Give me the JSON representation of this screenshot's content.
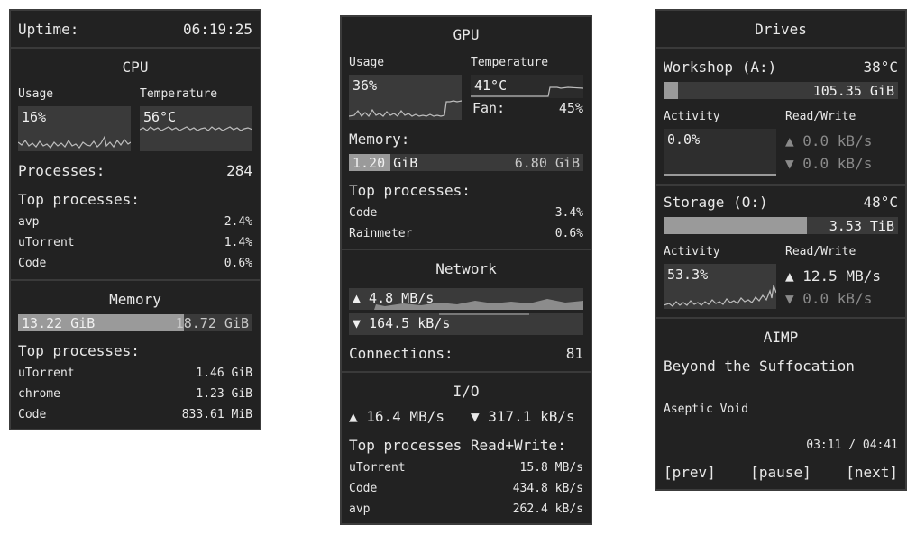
{
  "cpu_panel": {
    "uptime_label": "Uptime:",
    "uptime_value": "06:19:25",
    "title": "CPU",
    "usage_label": "Usage",
    "usage_value": "16%",
    "temp_label": "Temperature",
    "temp_value": "56°C",
    "processes_label": "Processes:",
    "processes_value": "284",
    "top_label": "Top processes:",
    "top": [
      {
        "name": "avp",
        "value": "2.4%"
      },
      {
        "name": "uTorrent",
        "value": "1.4%"
      },
      {
        "name": "Code",
        "value": "0.6%"
      }
    ],
    "memory_title": "Memory",
    "memory_used": "13.22 GiB",
    "memory_total": "18.72 GiB",
    "memory_fraction": 0.706,
    "mem_top_label": "Top processes:",
    "mem_top": [
      {
        "name": "uTorrent",
        "value": "1.46 GiB"
      },
      {
        "name": "chrome",
        "value": "1.23 GiB"
      },
      {
        "name": "Code",
        "value": "833.61 MiB"
      }
    ]
  },
  "gpu_panel": {
    "title": "GPU",
    "usage_label": "Usage",
    "usage_value": "36%",
    "temp_label": "Temperature",
    "temp_value": "41°C",
    "fan_label": "Fan:",
    "fan_value": "45%",
    "memory_label": "Memory:",
    "memory_used": "1.20 GiB",
    "memory_total": "6.80 GiB",
    "memory_fraction": 0.176,
    "top_label": "Top processes:",
    "top": [
      {
        "name": "Code",
        "value": "3.4%"
      },
      {
        "name": "Rainmeter",
        "value": "0.6%"
      }
    ],
    "network_title": "Network",
    "upload": "▲ 4.8 MB/s",
    "download": "▼ 164.5 kB/s",
    "connections_label": "Connections:",
    "connections_value": "81",
    "io_title": "I/O",
    "io_read": "▲ 16.4 MB/s",
    "io_write": "▼ 317.1 kB/s",
    "io_top_label": "Top processes Read+Write:",
    "io_top": [
      {
        "name": "uTorrent",
        "value": "15.8 MB/s"
      },
      {
        "name": "Code",
        "value": "434.8 kB/s"
      },
      {
        "name": "avp",
        "value": "262.4 kB/s"
      }
    ]
  },
  "drives_panel": {
    "title": "Drives",
    "drives": [
      {
        "name": "Workshop (A:)",
        "temp": "38°C",
        "free": "105.35 GiB",
        "used_fraction": 0.06,
        "activity_label": "Activity",
        "activity_value": "0.0%",
        "rw_label": "Read/Write",
        "read": "▲ 0.0 kB/s",
        "write": "▼ 0.0 kB/s"
      },
      {
        "name": "Storage (O:)",
        "temp": "48°C",
        "free": "3.53 TiB",
        "used_fraction": 0.61,
        "activity_label": "Activity",
        "activity_value": "53.3%",
        "rw_label": "Read/Write",
        "read": "▲ 12.5 MB/s",
        "write": "▼ 0.0 kB/s"
      }
    ],
    "player_title": "AIMP",
    "track_title": "Beyond the Suffocation",
    "track_artist": "Aseptic Void",
    "track_time": "03:11 / 04:41",
    "prev_label": "[prev]",
    "pause_label": "[pause]",
    "next_label": "[next]"
  },
  "colors": {
    "panel_bg": "#222222",
    "graph_bg": "#3a3a3a",
    "bar_fill": "#9a9a9a",
    "text": "#e8e8e8",
    "text_dim": "#8a8a8a"
  }
}
